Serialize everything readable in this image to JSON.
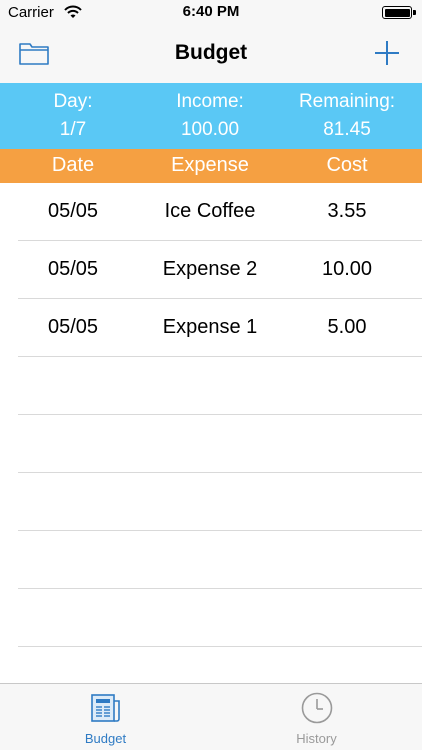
{
  "status": {
    "carrier": "Carrier",
    "time": "6:40 PM"
  },
  "nav": {
    "title": "Budget"
  },
  "summary": {
    "day_label": "Day:",
    "day_value": "1/7",
    "income_label": "Income:",
    "income_value": "100.00",
    "remaining_label": "Remaining:",
    "remaining_value": "81.45"
  },
  "table": {
    "headers": [
      "Date",
      "Expense",
      "Cost"
    ],
    "rows": [
      {
        "date": "05/05",
        "expense": "Ice Coffee",
        "cost": "3.55"
      },
      {
        "date": "05/05",
        "expense": "Expense 2",
        "cost": "10.00"
      },
      {
        "date": "05/05",
        "expense": "Expense 1",
        "cost": "5.00"
      }
    ]
  },
  "tabs": [
    {
      "label": "Budget",
      "icon": "newspaper-icon",
      "selected": true
    },
    {
      "label": "History",
      "icon": "clock-icon",
      "selected": false
    }
  ],
  "colors": {
    "summary_bg": "#5ac8f5",
    "header_bg": "#f5a042",
    "accent": "#2f7bc4"
  }
}
